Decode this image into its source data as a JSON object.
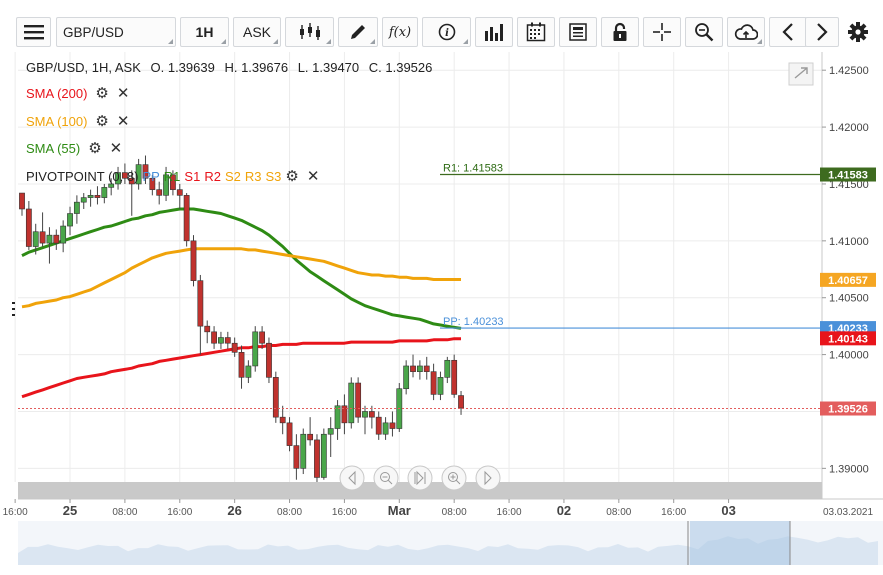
{
  "toolbar": {
    "symbol": "GBP/USD",
    "timeframe": "1H",
    "price_type": "ASK",
    "icons": [
      "menu-icon",
      "candlestick-type-icon",
      "draw-pen-icon",
      "function-icon",
      "info-icon",
      "bar-volume-icon",
      "calendar-icon",
      "news-icon",
      "lock-icon",
      "crosshair-icon",
      "zoom-icon",
      "cloud-upload-icon",
      "prev-arrow-icon",
      "next-arrow-icon",
      "settings-gear-icon"
    ],
    "function_label": "f(x)"
  },
  "header": {
    "instrument_line": "GBP/USD, 1H, ASK",
    "open": "O. 1.39639",
    "high": "H. 1.39676",
    "low": "L. 1.39470",
    "close": "C. 1.39526"
  },
  "indicators": [
    {
      "label": "SMA (200)",
      "color": "#e8141b"
    },
    {
      "label": "SMA (100)",
      "color": "#f0a30a"
    },
    {
      "label": "SMA (55)",
      "color": "#2e8b14"
    }
  ],
  "pivot": {
    "label": "PIVOTPOINT (0, 8)",
    "levels": [
      {
        "text": "PP",
        "color": "#4a90d9"
      },
      {
        "text": "R1",
        "color": "#2e8b14"
      },
      {
        "text": "S1",
        "color": "#e8141b"
      },
      {
        "text": "R2",
        "color": "#e8141b"
      },
      {
        "text": "S2",
        "color": "#f0a30a"
      },
      {
        "text": "R3",
        "color": "#f0a30a"
      },
      {
        "text": "S3",
        "color": "#f0a30a"
      }
    ],
    "r1_label": "R1: 1.41583",
    "pp_label": "PP: 1.40233"
  },
  "price_tags": [
    {
      "text": "1.41583",
      "value": 1.41583,
      "color": "#3e6b1f"
    },
    {
      "text": "1.40657",
      "value": 1.40657,
      "color": "#f5a623"
    },
    {
      "text": "1.40233",
      "value": 1.40233,
      "color": "#4a90d9"
    },
    {
      "text": "1.40143",
      "value": 1.40143,
      "color": "#e8141b"
    },
    {
      "text": "1.39526",
      "value": 1.39526,
      "color": "#e35d5d"
    }
  ],
  "date_stamp": "03.03.2021",
  "chart_data": {
    "type": "candlestick",
    "title": "GBP/USD, 1H, ASK",
    "ylim": [
      1.3888,
      1.4266
    ],
    "y_ticks": [
      "1.42500",
      "1.42000",
      "1.41500",
      "1.41000",
      "1.40500",
      "1.40000",
      "1.39500",
      "1.39000"
    ],
    "y_tick_values": [
      1.425,
      1.42,
      1.415,
      1.41,
      1.405,
      1.4,
      1.395,
      1.39
    ],
    "x_ticks": [
      {
        "label": "16:00",
        "slot": -1
      },
      {
        "label": "25",
        "slot": 7
      },
      {
        "label": "08:00",
        "slot": 15
      },
      {
        "label": "16:00",
        "slot": 23
      },
      {
        "label": "26",
        "slot": 31
      },
      {
        "label": "08:00",
        "slot": 39
      },
      {
        "label": "16:00",
        "slot": 47
      },
      {
        "label": "Mar",
        "slot": 55
      },
      {
        "label": "08:00",
        "slot": 63
      },
      {
        "label": "16:00",
        "slot": 71
      },
      {
        "label": "02",
        "slot": 79
      },
      {
        "label": "08:00",
        "slot": 87
      },
      {
        "label": "16:00",
        "slot": 95
      },
      {
        "label": "03",
        "slot": 103
      }
    ],
    "candles": [
      [
        1.4142,
        1.4142,
        1.4122,
        1.4128
      ],
      [
        1.4128,
        1.4135,
        1.4092,
        1.4095
      ],
      [
        1.4095,
        1.4115,
        1.4088,
        1.4108
      ],
      [
        1.4108,
        1.4125,
        1.4095,
        1.4098
      ],
      [
        1.4098,
        1.4112,
        1.408,
        1.4105
      ],
      [
        1.4105,
        1.411,
        1.4092,
        1.4098
      ],
      [
        1.4098,
        1.4118,
        1.409,
        1.4113
      ],
      [
        1.4113,
        1.413,
        1.4105,
        1.4124
      ],
      [
        1.4124,
        1.414,
        1.4115,
        1.4134
      ],
      [
        1.4134,
        1.4142,
        1.4128,
        1.4138
      ],
      [
        1.4138,
        1.4145,
        1.413,
        1.414
      ],
      [
        1.414,
        1.4148,
        1.4132,
        1.4138
      ],
      [
        1.4138,
        1.415,
        1.4133,
        1.4147
      ],
      [
        1.4147,
        1.4155,
        1.414,
        1.415
      ],
      [
        1.415,
        1.4165,
        1.4145,
        1.416
      ],
      [
        1.416,
        1.4168,
        1.415,
        1.4155
      ],
      [
        1.4155,
        1.4162,
        1.4122,
        1.415
      ],
      [
        1.415,
        1.4172,
        1.4145,
        1.4167
      ],
      [
        1.4167,
        1.4175,
        1.415,
        1.4155
      ],
      [
        1.4155,
        1.4158,
        1.414,
        1.4145
      ],
      [
        1.4145,
        1.4152,
        1.4132,
        1.414
      ],
      [
        1.414,
        1.4165,
        1.4135,
        1.4158
      ],
      [
        1.4158,
        1.4162,
        1.414,
        1.4145
      ],
      [
        1.4145,
        1.415,
        1.4128,
        1.414
      ],
      [
        1.414,
        1.4142,
        1.4095,
        1.41
      ],
      [
        1.41,
        1.4105,
        1.406,
        1.4065
      ],
      [
        1.4065,
        1.407,
        1.4,
        1.4025
      ],
      [
        1.4025,
        1.403,
        1.401,
        1.402
      ],
      [
        1.402,
        1.4025,
        1.4005,
        1.401
      ],
      [
        1.401,
        1.402,
        1.4005,
        1.4015
      ],
      [
        1.4015,
        1.402,
        1.4005,
        1.401
      ],
      [
        1.401,
        1.4015,
        1.3998,
        1.4002
      ],
      [
        1.4002,
        1.4008,
        1.397,
        1.398
      ],
      [
        1.398,
        1.3995,
        1.3975,
        1.399
      ],
      [
        1.399,
        1.4025,
        1.3985,
        1.402
      ],
      [
        1.402,
        1.4025,
        1.4005,
        1.401
      ],
      [
        1.401,
        1.4015,
        1.3975,
        1.398
      ],
      [
        1.398,
        1.3985,
        1.394,
        1.3945
      ],
      [
        1.3945,
        1.3955,
        1.393,
        1.394
      ],
      [
        1.394,
        1.3945,
        1.3915,
        1.392
      ],
      [
        1.392,
        1.393,
        1.389,
        1.39
      ],
      [
        1.39,
        1.3935,
        1.3895,
        1.393
      ],
      [
        1.393,
        1.3945,
        1.392,
        1.3925
      ],
      [
        1.3925,
        1.393,
        1.3888,
        1.3892
      ],
      [
        1.3892,
        1.3935,
        1.389,
        1.393
      ],
      [
        1.393,
        1.3945,
        1.391,
        1.3935
      ],
      [
        1.3935,
        1.396,
        1.3925,
        1.3955
      ],
      [
        1.3955,
        1.3965,
        1.393,
        1.394
      ],
      [
        1.394,
        1.398,
        1.3935,
        1.3975
      ],
      [
        1.3975,
        1.398,
        1.394,
        1.3945
      ],
      [
        1.3945,
        1.3955,
        1.393,
        1.395
      ],
      [
        1.395,
        1.3955,
        1.3935,
        1.3945
      ],
      [
        1.3945,
        1.395,
        1.3925,
        1.393
      ],
      [
        1.393,
        1.3945,
        1.3925,
        1.394
      ],
      [
        1.394,
        1.395,
        1.3928,
        1.3935
      ],
      [
        1.3935,
        1.3975,
        1.3932,
        1.397
      ],
      [
        1.397,
        1.3995,
        1.3965,
        1.399
      ],
      [
        1.399,
        1.4,
        1.398,
        1.3985
      ],
      [
        1.3985,
        1.3995,
        1.3978,
        1.399
      ],
      [
        1.399,
        1.3998,
        1.3978,
        1.3985
      ],
      [
        1.3985,
        1.3992,
        1.396,
        1.3965
      ],
      [
        1.3965,
        1.3985,
        1.396,
        1.398
      ],
      [
        1.398,
        1.3998,
        1.3975,
        1.3995
      ],
      [
        1.3995,
        1.4,
        1.3962,
        1.3965
      ],
      [
        1.3964,
        1.3968,
        1.3947,
        1.3953
      ]
    ],
    "series": [
      {
        "name": "SMA (200)",
        "color": "#e8141b",
        "values": [
          1.3963,
          1.3965,
          1.3967,
          1.3969,
          1.3971,
          1.3973,
          1.3975,
          1.3977,
          1.3979,
          1.398,
          1.3981,
          1.3982,
          1.3983,
          1.3985,
          1.3986,
          1.3987,
          1.3988,
          1.399,
          1.3991,
          1.3992,
          1.3994,
          1.3995,
          1.3996,
          1.3997,
          1.3998,
          1.3999,
          1.4,
          1.4001,
          1.4002,
          1.4003,
          1.4004,
          1.4005,
          1.4006,
          1.4006,
          1.4007,
          1.4007,
          1.4008,
          1.4008,
          1.4009,
          1.4009,
          1.4009,
          1.401,
          1.401,
          1.401,
          1.401,
          1.401,
          1.401,
          1.401,
          1.4011,
          1.4011,
          1.4011,
          1.4011,
          1.4011,
          1.4011,
          1.4011,
          1.4012,
          1.4012,
          1.4012,
          1.4012,
          1.4012,
          1.4013,
          1.4013,
          1.4013,
          1.4014,
          1.4014
        ]
      },
      {
        "name": "SMA (100)",
        "color": "#f0a30a",
        "values": [
          1.4042,
          1.4043,
          1.4045,
          1.4046,
          1.4047,
          1.4048,
          1.405,
          1.4051,
          1.4053,
          1.4055,
          1.4057,
          1.406,
          1.4063,
          1.4066,
          1.4069,
          1.4072,
          1.4076,
          1.4079,
          1.4082,
          1.4085,
          1.4087,
          1.4089,
          1.409,
          1.4091,
          1.4092,
          1.4093,
          1.4093,
          1.4093,
          1.4093,
          1.4093,
          1.4093,
          1.4093,
          1.4093,
          1.4092,
          1.4092,
          1.4091,
          1.409,
          1.4089,
          1.4088,
          1.4087,
          1.4086,
          1.4085,
          1.4084,
          1.4083,
          1.4082,
          1.408,
          1.4078,
          1.4076,
          1.4074,
          1.4072,
          1.4071,
          1.407,
          1.407,
          1.4069,
          1.4069,
          1.4068,
          1.4068,
          1.4067,
          1.4067,
          1.4067,
          1.4066,
          1.4066,
          1.4066,
          1.4066,
          1.4066
        ]
      },
      {
        "name": "SMA (55)",
        "color": "#2e8b14",
        "values": [
          1.4087,
          1.409,
          1.4092,
          1.4094,
          1.4096,
          1.4098,
          1.41,
          1.4102,
          1.4104,
          1.4106,
          1.4108,
          1.411,
          1.4112,
          1.4113,
          1.4115,
          1.4117,
          1.4119,
          1.412,
          1.4122,
          1.4123,
          1.4125,
          1.4126,
          1.4127,
          1.4128,
          1.4128,
          1.4128,
          1.4127,
          1.4126,
          1.4125,
          1.4124,
          1.4122,
          1.412,
          1.4118,
          1.4115,
          1.4112,
          1.4109,
          1.4105,
          1.41,
          1.4095,
          1.4089,
          1.4083,
          1.4078,
          1.4073,
          1.4069,
          1.4065,
          1.4061,
          1.4057,
          1.4053,
          1.4049,
          1.4046,
          1.4043,
          1.4041,
          1.4039,
          1.4037,
          1.4035,
          1.4034,
          1.4033,
          1.4032,
          1.4031,
          1.4029,
          1.4027,
          1.4026,
          1.4025,
          1.4024,
          1.4023
        ]
      }
    ],
    "pivot_levels": {
      "R1": 1.41583,
      "PP": 1.40233
    },
    "last_price": 1.39526,
    "grid": true
  }
}
